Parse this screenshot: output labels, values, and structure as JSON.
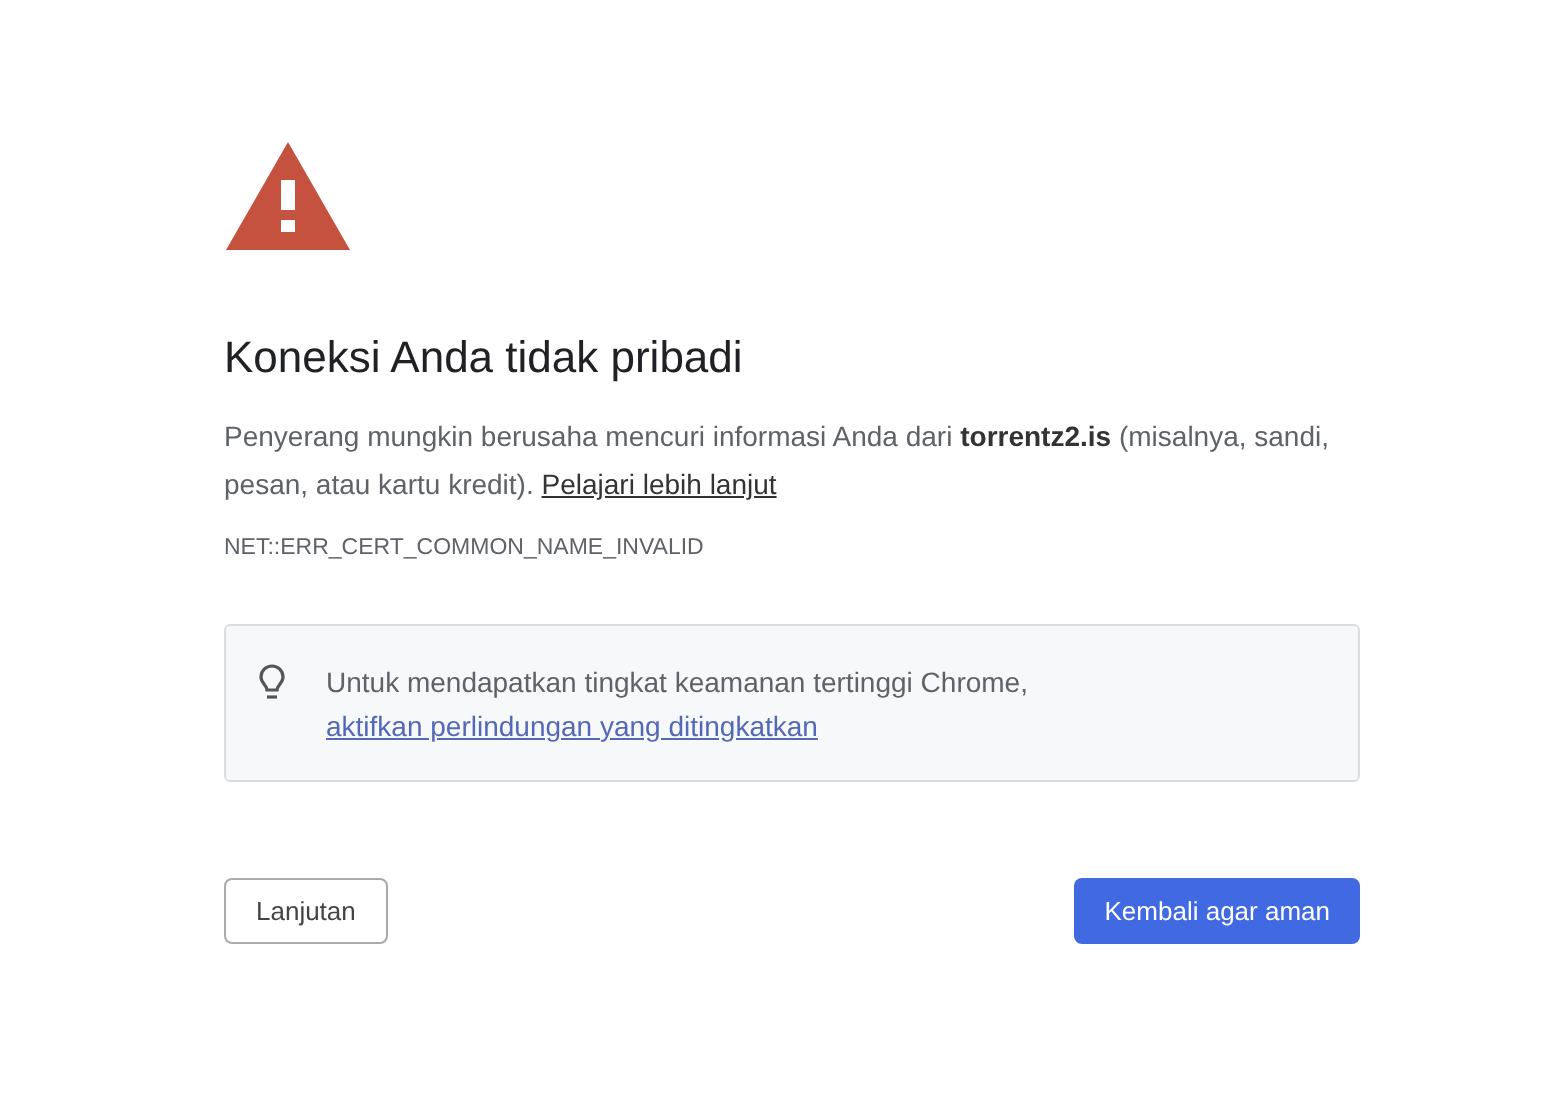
{
  "heading": "Koneksi Anda tidak pribadi",
  "message": {
    "text": "Penyerang mungkin berusaha mencuri informasi Anda dari **torrentz2.is** (misalnya, sandi, pesan, atau kartu kredit).",
    "link": "Pelajari lebih lanjut"
  },
  "error_code": "NET::ERR_CERT_COMMON_NAME_INVALID",
  "tip": {
    "text": "Untuk mendapatkan tingkat keamanan tertinggi Chrome,",
    "link": "aktifkan perlindungan yang ditingkatkan"
  },
  "buttons": [
    {
      "label": "Lanjutan",
      "kind": "secondary"
    },
    {
      "label": "Kembali agar aman",
      "kind": "primary"
    }
  ]
}
